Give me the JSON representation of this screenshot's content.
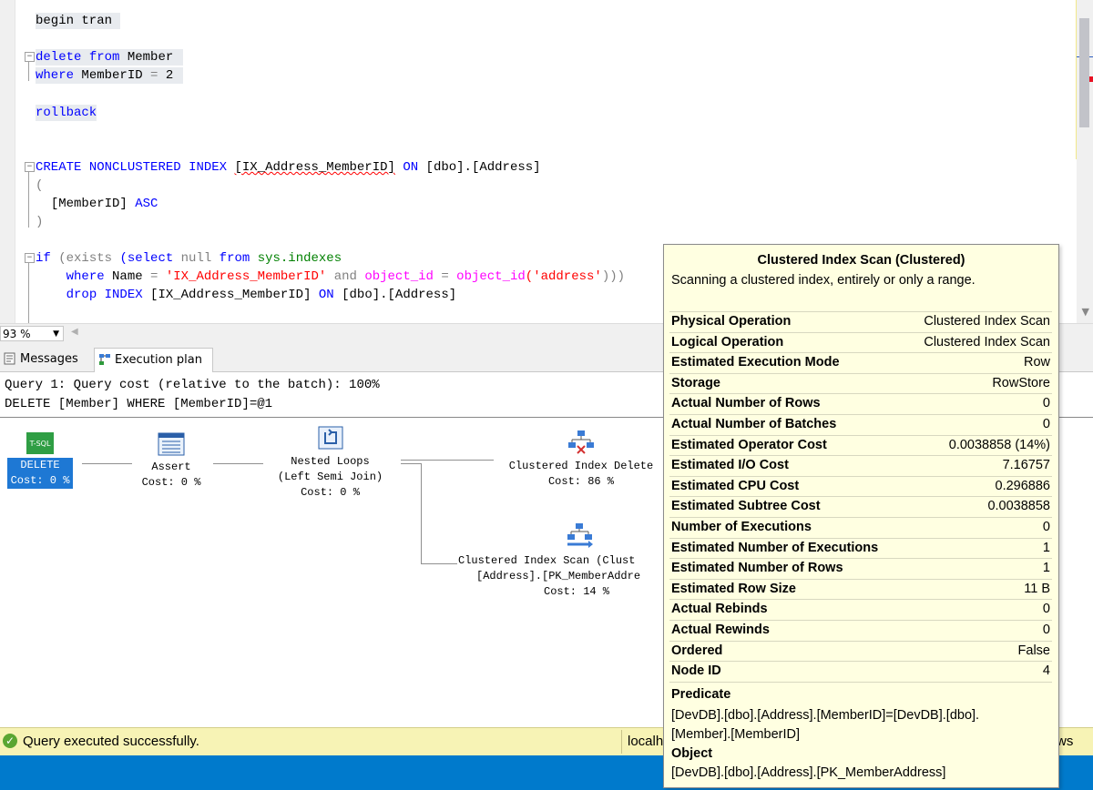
{
  "editor": {
    "lines": {
      "l1": "begin tran",
      "l2a": "delete",
      "l2b": "from",
      "l2c": "Member",
      "l3a": "where",
      "l3b": "MemberID",
      "l3c": "=",
      "l3d": "2",
      "l4": "rollback",
      "l5a": "CREATE",
      "l5b": "NONCLUSTERED",
      "l5c": "INDEX",
      "l5d": "[IX_Address_MemberID]",
      "l5e": "ON",
      "l5f": "[dbo].[Address]",
      "l6": "(",
      "l7a": "[MemberID]",
      "l7b": "ASC",
      "l8": ")",
      "l9a": "if",
      "l9b": "(exists",
      "l9c": "(select",
      "l9d": "null",
      "l9e": "from",
      "l9f": "sys.indexes",
      "l10a": "where",
      "l10b": "Name",
      "l10c": "=",
      "l10d": "'IX_Address_MemberID'",
      "l10e": "and",
      "l10f": "object_id",
      "l10g": "=",
      "l10h": "object_id",
      "l10i": "('address'",
      "l10j": ")))",
      "l11a": "drop",
      "l11b": "INDEX",
      "l11c": "[IX_Address_MemberID]",
      "l11d": "ON",
      "l11e": "[dbo].[Address]"
    },
    "zoom": "93 %"
  },
  "tabs": {
    "messages": "Messages",
    "execution_plan": "Execution plan"
  },
  "plan": {
    "query_line1": "Query 1: Query cost (relative to the batch): 100%",
    "query_line2": "DELETE [Member] WHERE [MemberID]=@1",
    "nodes": {
      "delete": {
        "icon_text": "T-SQL",
        "label": "DELETE",
        "cost": "Cost: 0 %"
      },
      "assert": {
        "label": "Assert",
        "cost": "Cost: 0 %"
      },
      "nested": {
        "label1": "Nested Loops",
        "label2": "(Left Semi Join)",
        "cost": "Cost: 0 %"
      },
      "cidelete": {
        "label": "Clustered Index Delete",
        "cost": "Cost: 86 %"
      },
      "ciscan": {
        "label1": "Clustered Index Scan (Clust",
        "label2": "[Address].[PK_MemberAddre",
        "cost": "Cost: 14 %"
      }
    }
  },
  "tooltip": {
    "title": "Clustered Index Scan (Clustered)",
    "description": "Scanning a clustered index, entirely or only a range.",
    "properties": [
      {
        "key": "Physical Operation",
        "value": "Clustered Index Scan"
      },
      {
        "key": "Logical Operation",
        "value": "Clustered Index Scan"
      },
      {
        "key": "Estimated Execution Mode",
        "value": "Row"
      },
      {
        "key": "Storage",
        "value": "RowStore"
      },
      {
        "key": "Actual Number of Rows",
        "value": "0"
      },
      {
        "key": "Actual Number of Batches",
        "value": "0"
      },
      {
        "key": "Estimated Operator Cost",
        "value": "0.0038858 (14%)"
      },
      {
        "key": "Estimated I/O Cost",
        "value": "7.16757"
      },
      {
        "key": "Estimated CPU Cost",
        "value": "0.296886"
      },
      {
        "key": "Estimated Subtree Cost",
        "value": "0.0038858"
      },
      {
        "key": "Number of Executions",
        "value": "0"
      },
      {
        "key": "Estimated Number of Executions",
        "value": "1"
      },
      {
        "key": "Estimated Number of Rows",
        "value": "1"
      },
      {
        "key": "Estimated Row Size",
        "value": "11 B"
      },
      {
        "key": "Actual Rebinds",
        "value": "0"
      },
      {
        "key": "Actual Rewinds",
        "value": "0"
      },
      {
        "key": "Ordered",
        "value": "False"
      },
      {
        "key": "Node ID",
        "value": "4"
      }
    ],
    "predicate_label": "Predicate",
    "predicate_value": "[DevDB].[dbo].[Address].[MemberID]=[DevDB].[dbo].[Member].[MemberID]",
    "object_label": "Object",
    "object_value": "[DevDB].[dbo].[Address].[PK_MemberAddress]"
  },
  "status": {
    "text": "Query executed successfully.",
    "server": "localh",
    "tail": "ws"
  },
  "colors": {
    "status_bg": "#f7f3b5",
    "accent_blue": "#007acc",
    "tooltip_bg": "#ffffe1",
    "selected_node": "#1e78d4"
  }
}
